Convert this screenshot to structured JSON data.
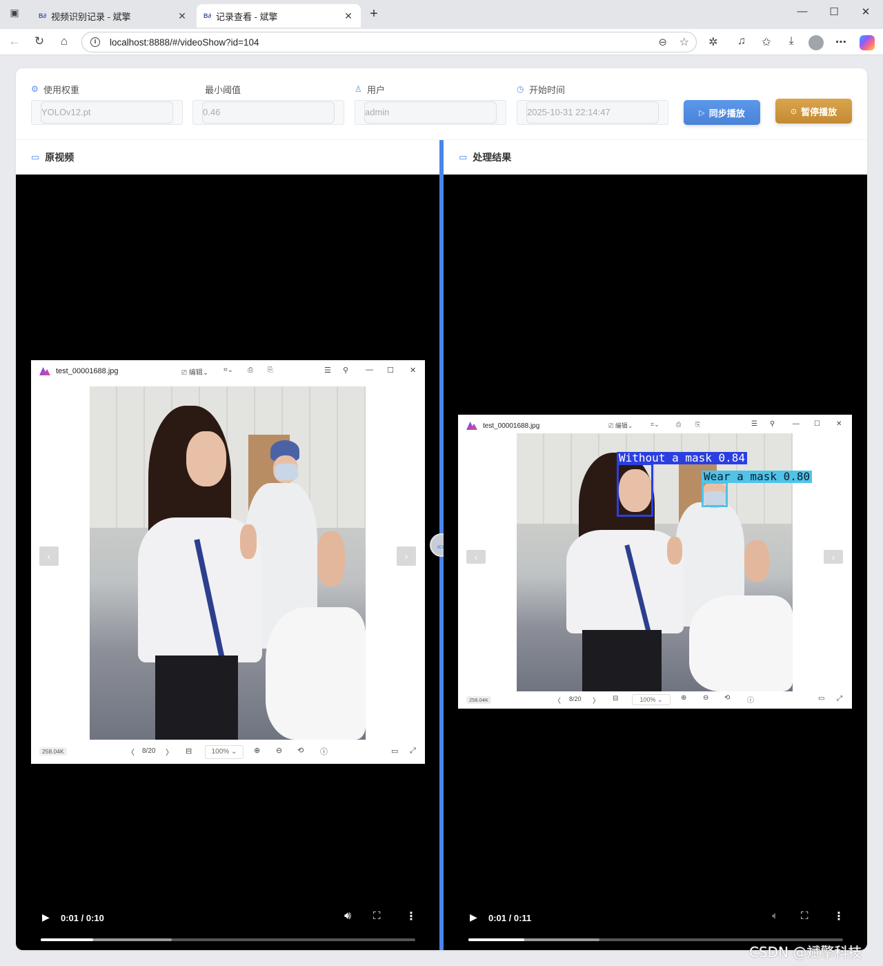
{
  "browser": {
    "tabs": [
      {
        "label": "视频识别记录 - 斌擎",
        "favicon": "B∂"
      },
      {
        "label": "记录查看 - 斌擎",
        "favicon": "B∂"
      }
    ],
    "url": "localhost:8888/#/videoShow?id=104"
  },
  "form": {
    "weight_label": "使用权重",
    "weight_value": "YOLOv12.pt",
    "threshold_label": "最小阈值",
    "threshold_value": "0.46",
    "user_label": "用户",
    "user_value": "admin",
    "start_label": "开始时间",
    "start_value": "2025-10-31 22:14:47",
    "sync_button": "同步播放",
    "pause_button": "暂停播放"
  },
  "left_panel": {
    "title": "原视频",
    "time": "0:01 / 0:10",
    "progress": 0.14,
    "buffered": 0.35
  },
  "right_panel": {
    "title": "处理结果",
    "time": "0:01 / 0:11",
    "progress": 0.15,
    "buffered": 0.35
  },
  "viewer": {
    "filename": "test_00001688.jpg",
    "edit_label": "编辑",
    "page": "8/20",
    "zoom": "100%",
    "filesize": "258.04K"
  },
  "detections": [
    {
      "label": "Without a mask 0.84",
      "color": "#2b3fe0"
    },
    {
      "label": "Wear a mask 0.80",
      "color": "#4fc3e8"
    }
  ],
  "watermark": "CSDN @斌擎科技"
}
